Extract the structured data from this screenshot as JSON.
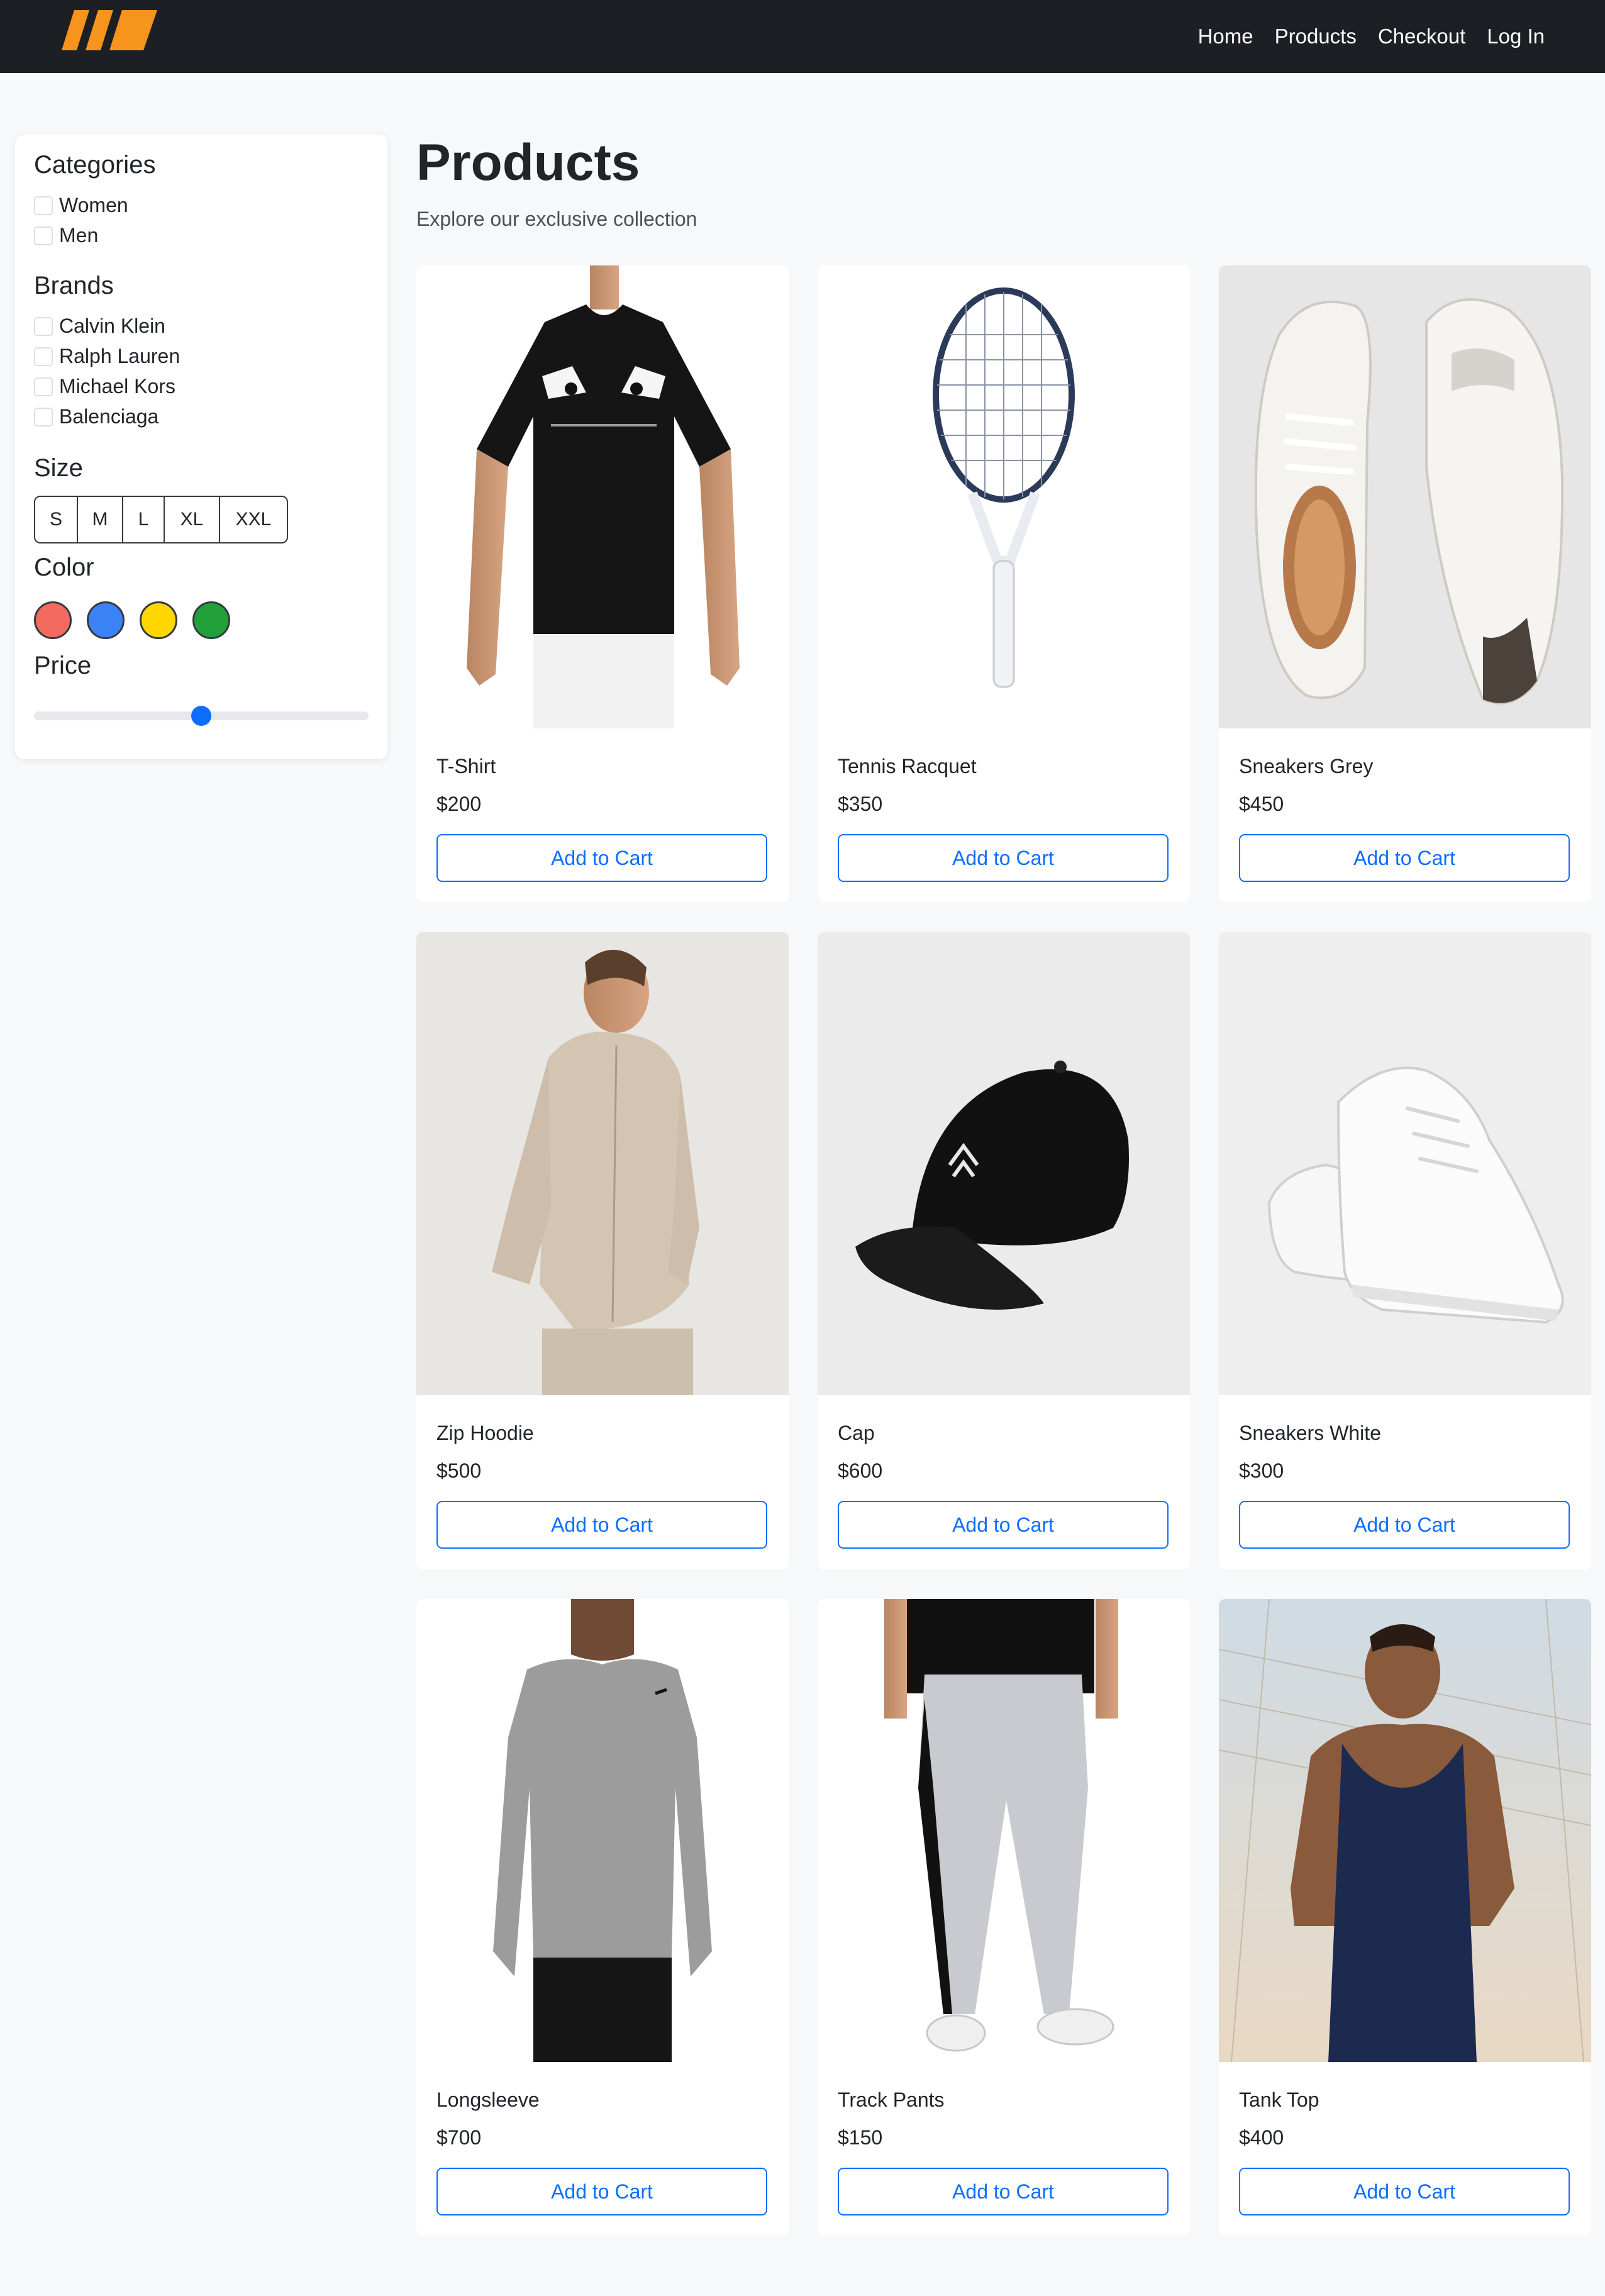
{
  "nav": {
    "logo_icon": "brand-stripes-logo",
    "links": [
      {
        "label": "Home"
      },
      {
        "label": "Products"
      },
      {
        "label": "Checkout"
      },
      {
        "label": "Log In"
      }
    ]
  },
  "filters": {
    "categories": {
      "heading": "Categories",
      "items": [
        {
          "label": "Women",
          "checked": false
        },
        {
          "label": "Men",
          "checked": false
        }
      ]
    },
    "brands": {
      "heading": "Brands",
      "items": [
        {
          "label": "Calvin Klein",
          "checked": false
        },
        {
          "label": "Ralph Lauren",
          "checked": false
        },
        {
          "label": "Michael Kors",
          "checked": false
        },
        {
          "label": "Balenciaga",
          "checked": false
        }
      ]
    },
    "size": {
      "heading": "Size",
      "options": [
        "S",
        "M",
        "L",
        "XL",
        "XXL"
      ]
    },
    "color": {
      "heading": "Color",
      "swatches": [
        "#f26b5e",
        "#3b82f6",
        "#ffd600",
        "#22a03a"
      ]
    },
    "price": {
      "heading": "Price",
      "slider_fraction": 0.5
    }
  },
  "main": {
    "title": "Products",
    "subtitle": "Explore our exclusive collection",
    "add_to_cart_label": "Add to Cart",
    "products": [
      {
        "name": "T-Shirt",
        "price": "$200",
        "image": "tshirt-photo"
      },
      {
        "name": "Tennis Racquet",
        "price": "$350",
        "image": "tennis-racquet-photo"
      },
      {
        "name": "Sneakers Grey",
        "price": "$450",
        "image": "sneakers-grey-photo"
      },
      {
        "name": "Zip Hoodie",
        "price": "$500",
        "image": "zip-hoodie-photo"
      },
      {
        "name": "Cap",
        "price": "$600",
        "image": "cap-photo"
      },
      {
        "name": "Sneakers White",
        "price": "$300",
        "image": "sneakers-white-photo"
      },
      {
        "name": "Longsleeve",
        "price": "$700",
        "image": "longsleeve-photo"
      },
      {
        "name": "Track Pants",
        "price": "$150",
        "image": "track-pants-photo"
      },
      {
        "name": "Tank Top",
        "price": "$400",
        "image": "tank-top-photo"
      }
    ]
  },
  "colors": {
    "nav_bg": "#1c1f24",
    "page_bg": "#f7f8fa",
    "accent": "#0d6efd",
    "logo": "#f7941d"
  }
}
